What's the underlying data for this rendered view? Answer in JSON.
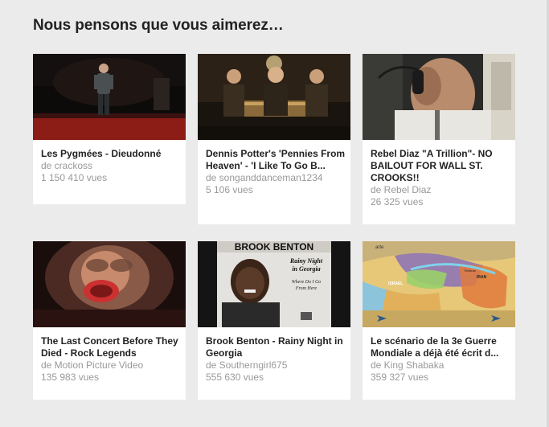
{
  "section": {
    "title": "Nous pensons que vous aimerez…"
  },
  "videos": [
    {
      "title": "Les Pygmées - Dieudonné",
      "channel": "de crackoss",
      "views": "1 150 410 vues",
      "thumbnail": "stage-comedian"
    },
    {
      "title": "Dennis Potter's 'Pennies From Heaven' - 'I Like To Go B...",
      "channel": "de songanddanceman1234",
      "views": "5 106 vues",
      "thumbnail": "three-men-singing"
    },
    {
      "title": "Rebel Diaz \"A Trillion\"- NO BAILOUT FOR WALL ST. CROOKS!!",
      "channel": "de Rebel Diaz",
      "views": "26 325 vues",
      "thumbnail": "trader-on-phone"
    },
    {
      "title": "The Last Concert Before They Died - Rock Legends",
      "channel": "de Motion Picture Video",
      "views": "135 983 vues",
      "thumbnail": "singer-at-microphone"
    },
    {
      "title": "Brook Benton - Rainy Night in Georgia",
      "channel": "de Southerngirl675",
      "views": "555 630 vues",
      "thumbnail": "album-cover",
      "thumb_text": {
        "artist": "BROOK BENTON",
        "song_line1": "Rainy Night",
        "song_line2": "in Georgia",
        "sub_line1": "Where Do I Go",
        "sub_line2": "From Here"
      }
    },
    {
      "title": "Le scénario de la 3e Guerre Mondiale a déjà été écrit d...",
      "channel": "de King Shabaka",
      "views": "359 327 vues",
      "thumbnail": "map-middle-east",
      "thumb_text": {
        "logo": "arte",
        "label_israel": "ISRAEL",
        "label_iran": "IRAN",
        "label_tehran": "Téhéran"
      }
    }
  ]
}
